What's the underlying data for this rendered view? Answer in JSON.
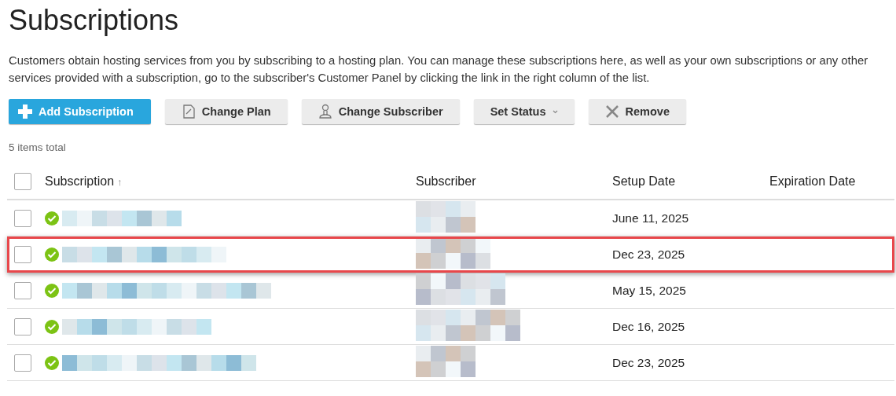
{
  "title": "Subscriptions",
  "description": "Customers obtain hosting services from you by subscribing to a hosting plan. You can manage these subscriptions here, as well as your own subscriptions or any other services provided with a subscription, go to the subscriber's Customer Panel by clicking the link in the right column of the list.",
  "toolbar": [
    {
      "label": "Add Subscription",
      "kind": "primary"
    },
    {
      "label": "Change Plan",
      "kind": "plain"
    },
    {
      "label": "Change Subscriber",
      "kind": "plain"
    },
    {
      "label": "Set Status",
      "kind": "dropdown"
    },
    {
      "label": "Remove",
      "kind": "plain"
    }
  ],
  "items_total": "5 items total",
  "table": {
    "all_checked": false,
    "columns": [
      {
        "label": "Subscription",
        "sort": "↑"
      },
      {
        "label": "Subscriber"
      },
      {
        "label": "Setup Date"
      },
      {
        "label": "Expiration Date"
      }
    ],
    "rows": [
      {
        "checked": false,
        "highlighted": false,
        "setup_date": "June 11, 2025"
      },
      {
        "checked": false,
        "highlighted": true,
        "setup_date": "Dec 23, 2025"
      },
      {
        "checked": false,
        "highlighted": false,
        "setup_date": "May 15, 2025"
      },
      {
        "checked": false,
        "highlighted": false,
        "setup_date": "Dec 16, 2025"
      },
      {
        "checked": false,
        "highlighted": false,
        "setup_date": "Dec 23, 2025"
      }
    ]
  }
}
